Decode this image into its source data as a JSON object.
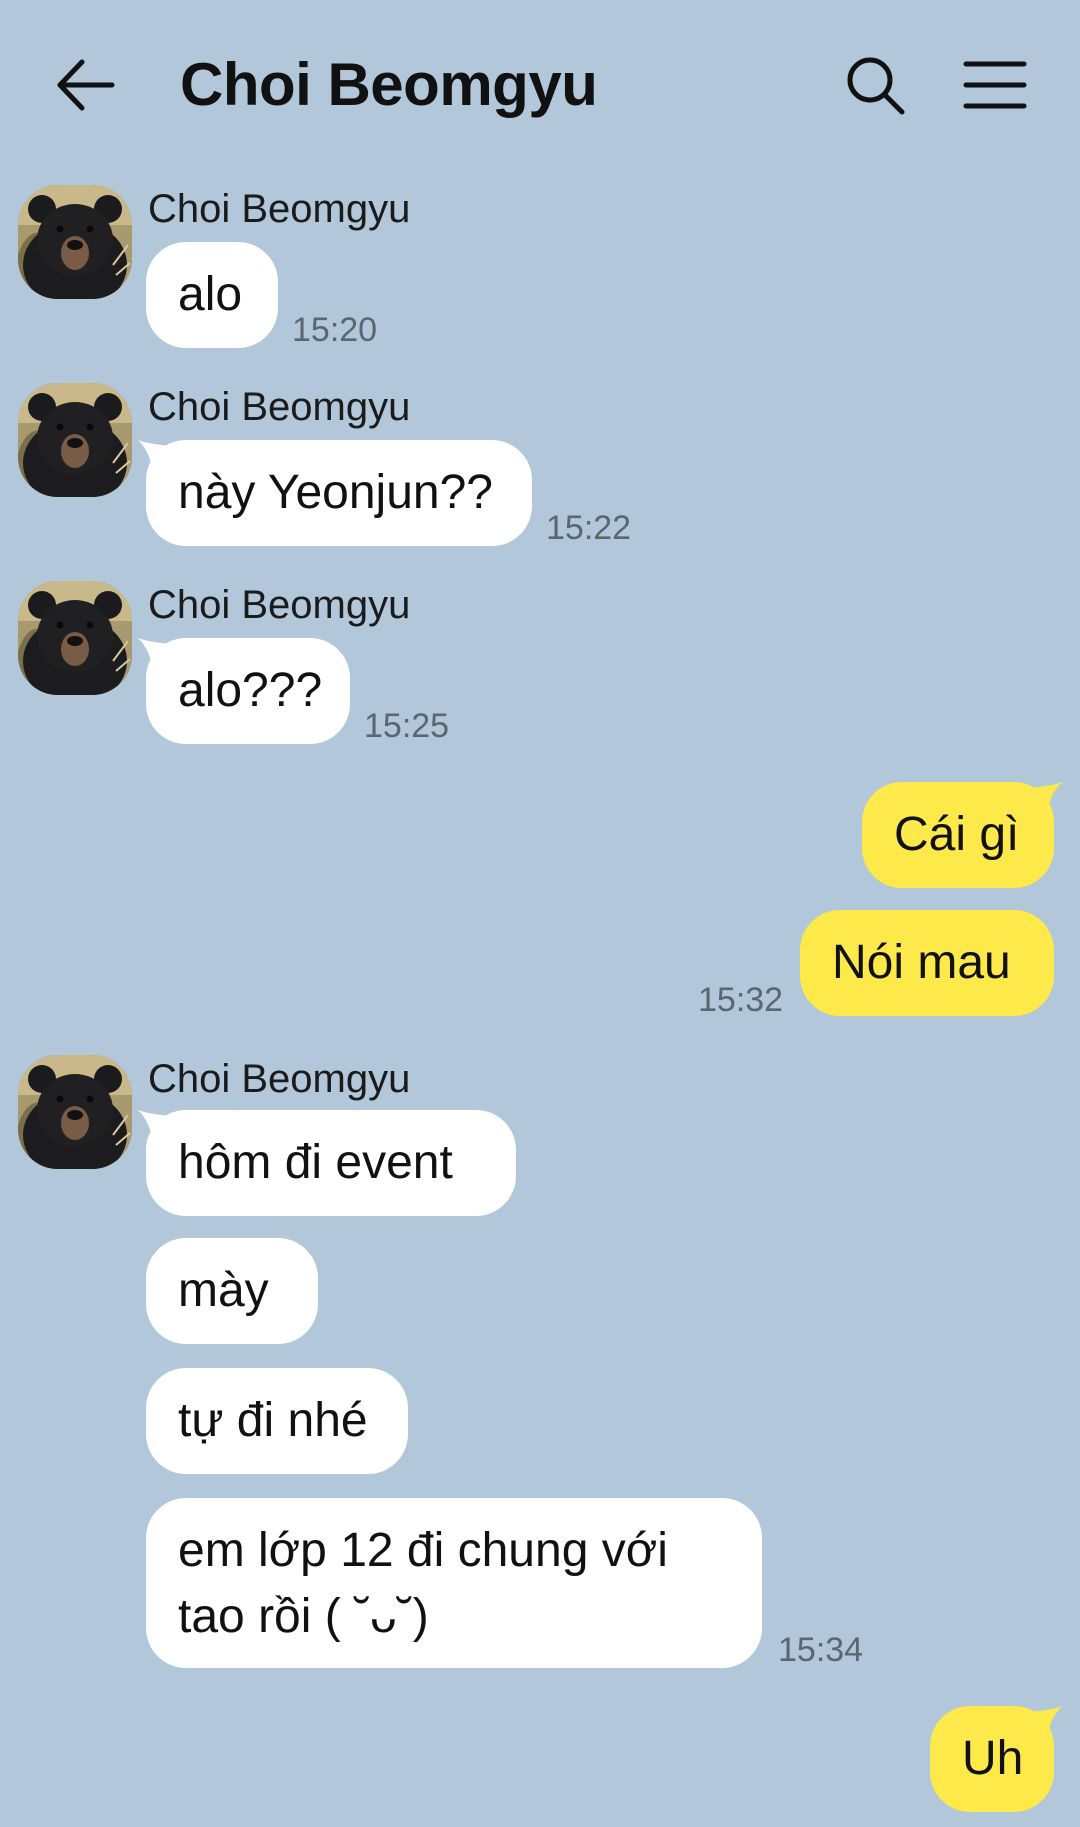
{
  "header": {
    "title": "Choi Beomgyu"
  },
  "messages": [
    {
      "sender": "Choi Beomgyu",
      "text": "alo",
      "time": "15:20"
    },
    {
      "sender": "Choi Beomgyu",
      "text": "này Yeonjun??",
      "time": "15:22"
    },
    {
      "sender": "Choi Beomgyu",
      "text": "alo???",
      "time": "15:25"
    },
    {
      "text": "Cái gì"
    },
    {
      "text": "Nói mau",
      "time": "15:32"
    },
    {
      "sender": "Choi Beomgyu",
      "text": "hôm đi event"
    },
    {
      "text": "mày"
    },
    {
      "text": "tự đi nhé"
    },
    {
      "text": "em lớp 12 đi chung với tao rồi ( ˘ᴗ˘)",
      "time": "15:34"
    },
    {
      "text": "Uh"
    }
  ],
  "colors": {
    "background": "#b2c7da",
    "incoming_bubble": "#ffffff",
    "outgoing_bubble": "#fee94a"
  },
  "icons": [
    "arrow-left-icon",
    "search-icon",
    "menu-icon",
    "bear-avatar"
  ]
}
